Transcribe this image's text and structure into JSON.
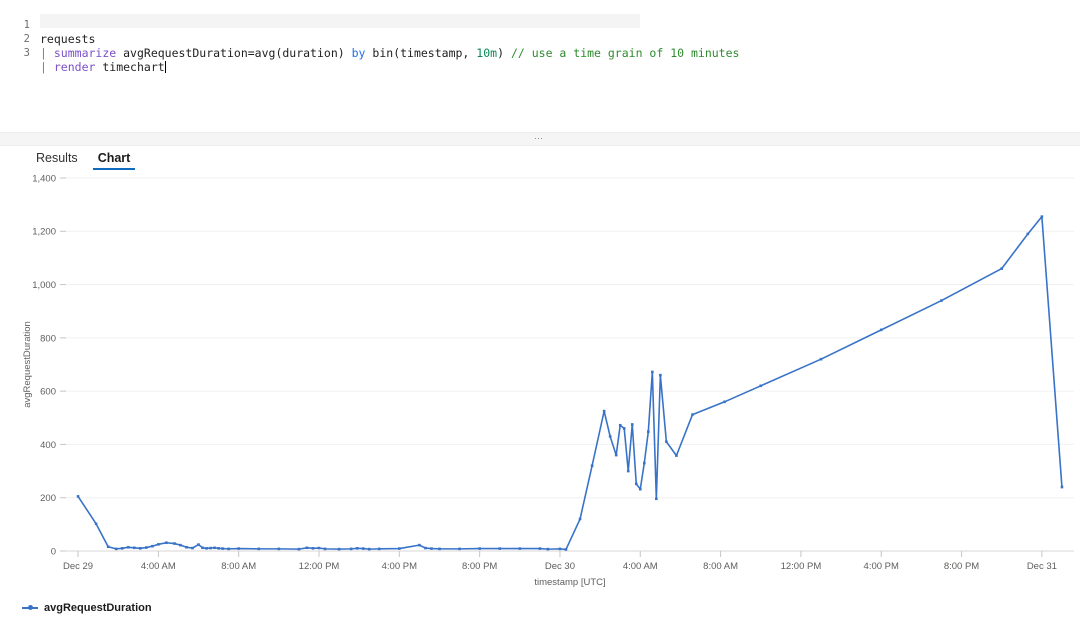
{
  "editor": {
    "lines": [
      {
        "num": "1",
        "text": "requests"
      },
      {
        "num": "2",
        "text": "| summarize avgRequestDuration=avg(duration) by bin(timestamp, 10m) // use a time grain of 10 minutes"
      },
      {
        "num": "3",
        "text": "| render timechart"
      }
    ],
    "line1": {
      "num": "1",
      "table": "requests"
    },
    "line2": {
      "num": "2",
      "pipe": "|",
      "keyword": "summarize",
      "expr": "avgRequestDuration=avg(duration)",
      "by": "by",
      "bin": "bin(timestamp,",
      "binarg": "10m",
      "binclose": ")",
      "comment": "// use a time grain of 10 minutes"
    },
    "line3": {
      "num": "3",
      "pipe": "|",
      "keyword": "render",
      "arg": "timechart"
    }
  },
  "splitter": {
    "handle": "⋯"
  },
  "tabs": [
    {
      "label": "Results",
      "active": false
    },
    {
      "label": "Chart",
      "active": true
    }
  ],
  "legend": {
    "items": [
      {
        "label": "avgRequestDuration",
        "color": "#3873c8"
      }
    ]
  },
  "chart_data": {
    "type": "line",
    "title": "",
    "xlabel": "timestamp [UTC]",
    "ylabel": "avgRequestDuration",
    "ylim": [
      0,
      1400
    ],
    "yticks": [
      0,
      200,
      400,
      600,
      800,
      1000,
      1200,
      1400
    ],
    "ytick_labels": [
      "0",
      "200",
      "400",
      "600",
      "800",
      "1,000",
      "1,200",
      "1,400"
    ],
    "xtick_labels": [
      "Dec 29",
      "4:00 AM",
      "8:00 AM",
      "12:00 PM",
      "4:00 PM",
      "8:00 PM",
      "Dec 30",
      "4:00 AM",
      "8:00 AM",
      "12:00 PM",
      "4:00 PM",
      "8:00 PM",
      "Dec 31"
    ],
    "xtick_positions": [
      0,
      4,
      8,
      12,
      16,
      20,
      24,
      28,
      32,
      36,
      40,
      44,
      48
    ],
    "xlim_hours": [
      -0.6,
      49.6
    ],
    "grid": true,
    "legend_position": "bottom-left",
    "series": [
      {
        "name": "avgRequestDuration",
        "color": "#3873c8",
        "x": [
          0.0,
          0.9,
          1.5,
          1.9,
          2.2,
          2.5,
          2.8,
          3.1,
          3.4,
          3.7,
          4.0,
          4.4,
          4.8,
          5.1,
          5.4,
          5.7,
          6.0,
          6.2,
          6.4,
          6.6,
          6.8,
          7.0,
          7.2,
          7.5,
          8.0,
          9.0,
          10.0,
          11.0,
          11.4,
          11.7,
          12.0,
          12.3,
          13.0,
          13.6,
          13.9,
          14.2,
          14.5,
          15.0,
          16.0,
          17.0,
          17.3,
          17.6,
          18.0,
          19.0,
          20.0,
          21.0,
          22.0,
          23.0,
          23.4,
          24.0,
          24.3,
          25.0,
          25.6,
          26.2,
          26.5,
          26.8,
          27.0,
          27.2,
          27.4,
          27.6,
          27.8,
          28.0,
          28.2,
          28.4,
          28.6,
          28.8,
          29.0,
          29.3,
          29.8,
          30.6,
          32.2,
          34.0,
          37.0,
          40.0,
          43.0,
          46.0,
          47.3,
          48.0,
          49.0
        ],
        "y": [
          205,
          102,
          16,
          8,
          10,
          14,
          12,
          10,
          13,
          18,
          25,
          31,
          28,
          22,
          14,
          11,
          24,
          12,
          10,
          11,
          12,
          10,
          9,
          8,
          9,
          8,
          8,
          7,
          12,
          10,
          11,
          8,
          7,
          8,
          10,
          9,
          7,
          8,
          9,
          22,
          11,
          9,
          8,
          8,
          9,
          9,
          9,
          9,
          7,
          8,
          6,
          120,
          320,
          525,
          430,
          360,
          472,
          460,
          300,
          475,
          252,
          232,
          330,
          448,
          672,
          196,
          660,
          410,
          358,
          512,
          560,
          620,
          720,
          830,
          940,
          1060,
          1190,
          1255,
          240
        ]
      }
    ]
  }
}
